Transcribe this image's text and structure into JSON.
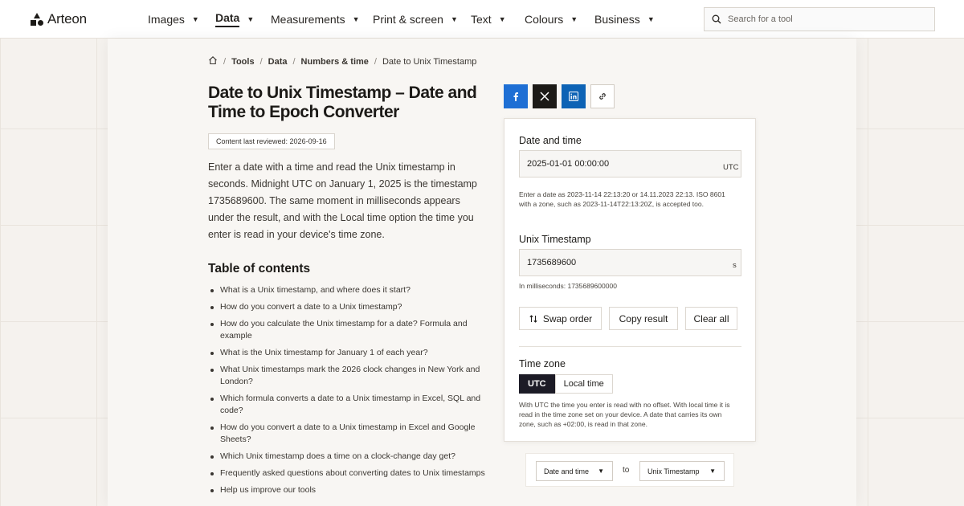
{
  "header": {
    "logo_text": "Arteon",
    "nav": [
      {
        "label": "Images",
        "active": false
      },
      {
        "label": "Data",
        "active": true
      },
      {
        "label": "Measurements",
        "active": false
      },
      {
        "label": "Print & screen",
        "active": false
      },
      {
        "label": "Text",
        "active": false
      },
      {
        "label": "Colours",
        "active": false
      },
      {
        "label": "Business",
        "active": false
      }
    ],
    "search_placeholder": "Search for a tool"
  },
  "breadcrumb": {
    "items": [
      "Tools",
      "Data",
      "Numbers & time"
    ],
    "current": "Date to Unix Timestamp"
  },
  "article": {
    "title": "Date to Unix Timestamp – Date and Time to Epoch Converter",
    "reviewed": "Content last reviewed: 2026-09-16",
    "intro": "Enter a date with a time and read the Unix timestamp in seconds. Midnight UTC on January 1, 2025 is the timestamp 1735689600. The same moment in milliseconds appears under the result, and with the Local time option the time you enter is read in your device's time zone.",
    "toc_title": "Table of contents",
    "toc": [
      "What is a Unix timestamp, and where does it start?",
      "How do you convert a date to a Unix timestamp?",
      "How do you calculate the Unix timestamp for a date? Formula and example",
      "What is the Unix timestamp for January 1 of each year?",
      "What Unix timestamps mark the 2026 clock changes in New York and London?",
      "Which formula converts a date to a Unix timestamp in Excel, SQL and code?",
      "How do you convert a date to a Unix timestamp in Excel and Google Sheets?",
      "Which Unix timestamp does a time on a clock-change day get?",
      "Frequently asked questions about converting dates to Unix timestamps",
      "Help us improve our tools"
    ]
  },
  "share": {
    "icons": [
      "facebook-icon",
      "x-icon",
      "linkedin-icon",
      "link-icon"
    ],
    "colors": {
      "facebook": "#1e6fd4",
      "x": "#1c1a17",
      "linkedin": "#0d63b5"
    }
  },
  "converter": {
    "date_label": "Date and time",
    "date_value": "2025-01-01 00:00:00",
    "date_unit": "UTC",
    "date_hint": "Enter a date as 2023-11-14 22:13:20 or 14.11.2023 22:13. ISO 8601 with a zone, such as 2023-11-14T22:13:20Z, is accepted too.",
    "ts_label": "Unix Timestamp",
    "ts_value": "1735689600",
    "ts_unit": "s",
    "ms_note": "In milliseconds: 1735689600000",
    "buttons": {
      "swap": "Swap order",
      "copy": "Copy result",
      "clear": "Clear all"
    },
    "tz_label": "Time zone",
    "tz_options": [
      "UTC",
      "Local time"
    ],
    "tz_selected": "UTC",
    "tz_note": "With UTC the time you enter is read with no offset. With local time it is read in the time zone set on your device. A date that carries its own zone, such as +02:00, is read in that zone."
  },
  "selector": {
    "from": "Date and time",
    "to_word": "to",
    "to": "Unix Timestamp"
  }
}
